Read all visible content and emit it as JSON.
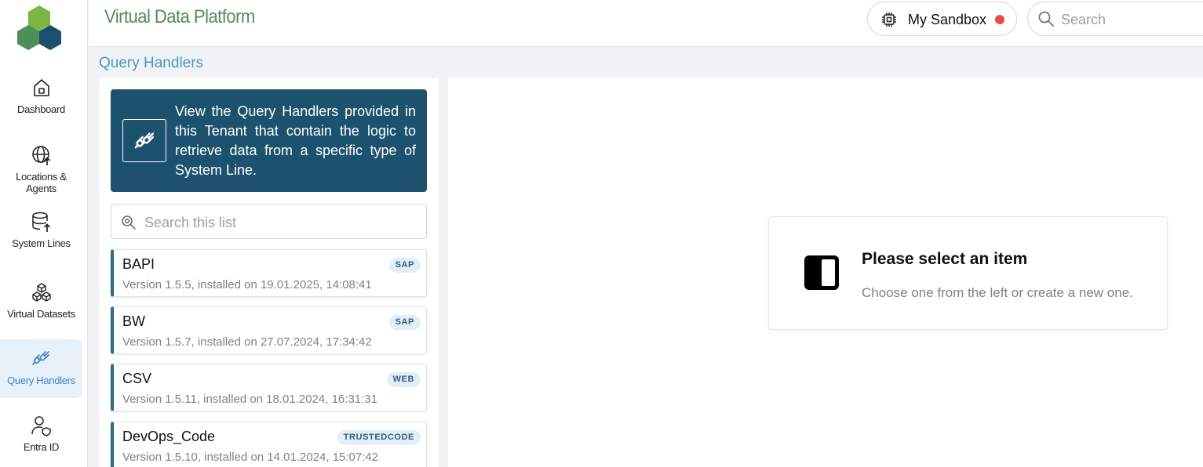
{
  "app": {
    "title": "Virtual Data Platform",
    "logo_icon": "hexagon-cluster-logo",
    "colors": {
      "brand_green": "#4e8e5a",
      "accent_blue": "#3d86c6",
      "info_box": "#1d526e",
      "status_dot": "#e84a4a"
    }
  },
  "header": {
    "sandbox_label": "My Sandbox",
    "sandbox_icon": "chip-icon",
    "search_placeholder": "Search"
  },
  "sidebar": {
    "items": [
      {
        "label": "Dashboard",
        "icon": "home-icon",
        "active": false
      },
      {
        "label": "Locations & Agents",
        "icon": "globe-upload-icon",
        "active": false
      },
      {
        "label": "System Lines",
        "icon": "database-upload-icon",
        "active": false
      },
      {
        "label": "Virtual Datasets",
        "icon": "cubes-icon",
        "active": false
      },
      {
        "label": "Query Handlers",
        "icon": "plug-icon",
        "active": true
      },
      {
        "label": "Entra ID",
        "icon": "user-shield-icon",
        "active": false
      }
    ]
  },
  "page": {
    "title": "Query Handlers"
  },
  "info_box": {
    "icon": "plug-icon",
    "text": "View the Query Handlers provided in this Tenant that contain the logic to retrieve data from a specific type of System Line."
  },
  "list": {
    "search_placeholder": "Search this list",
    "items": [
      {
        "name": "BAPI",
        "version": "Version 1.5.5, installed on 19.01.2025, 14:08:41",
        "badge": "SAP"
      },
      {
        "name": "BW",
        "version": "Version 1.5.7, installed on 27.07.2024, 17:34:42",
        "badge": "SAP"
      },
      {
        "name": "CSV",
        "version": "Version 1.5.11, installed on 18.01.2024, 16:31:31",
        "badge": "WEB"
      },
      {
        "name": "DevOps_Code",
        "version": "Version 1.5.10, installed on 14.01.2024, 15:07:42",
        "badge": "TRUSTEDCODE"
      }
    ]
  },
  "detail": {
    "empty_icon": "split-panel-icon",
    "title": "Please select an item",
    "subtitle": "Choose one from the left or create a new one."
  }
}
